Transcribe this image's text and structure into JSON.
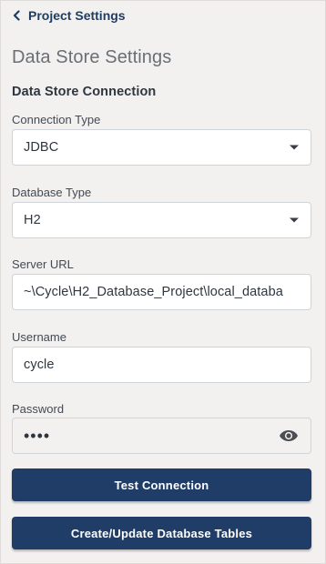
{
  "back_link": {
    "label": "Project Settings",
    "icon": "chevron-left-icon"
  },
  "page": {
    "title": "Data Store Settings",
    "section_title": "Data Store Connection"
  },
  "fields": {
    "connection_type": {
      "label": "Connection Type",
      "value": "JDBC"
    },
    "database_type": {
      "label": "Database Type",
      "value": "H2"
    },
    "server_url": {
      "label": "Server URL",
      "value": "~\\Cycle\\H2_Database_Project\\local_databa"
    },
    "username": {
      "label": "Username",
      "value": "cycle"
    },
    "password": {
      "label": "Password",
      "masked_value": "••••",
      "visibility_icon": "eye-icon"
    }
  },
  "buttons": {
    "test_connection": "Test Connection",
    "create_update_tables": "Create/Update Database Tables"
  },
  "colors": {
    "background": "#f2f1f0",
    "primary_button": "#1f3d66",
    "link": "#1e3d63",
    "input_border": "#cfd4da"
  }
}
